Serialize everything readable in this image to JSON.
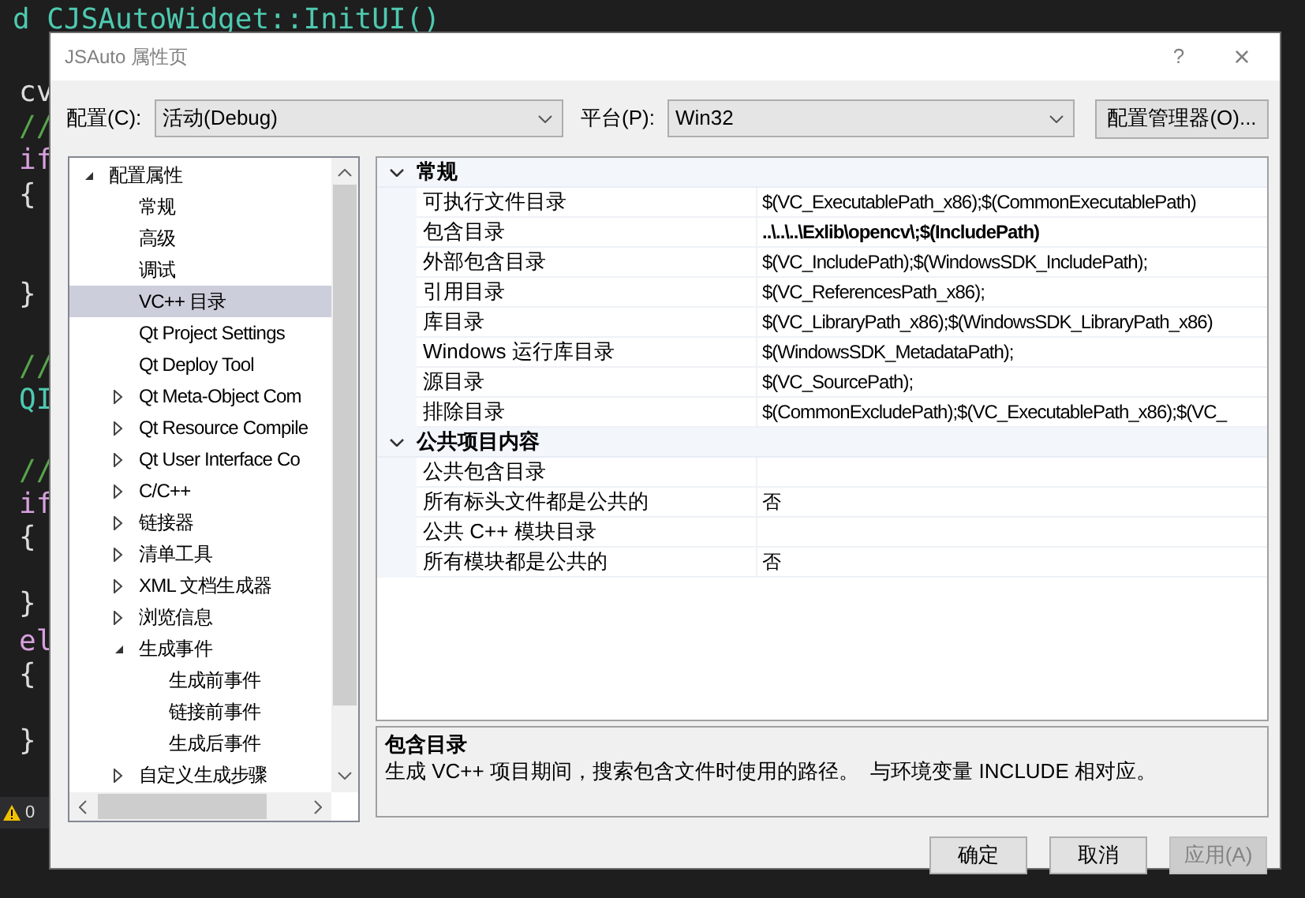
{
  "editor": {
    "lines": [
      {
        "text": "d CJSAutoWidget::InitUI()",
        "kind": "func"
      },
      {
        "text": "cv",
        "kind": "ident"
      },
      {
        "text": "//",
        "kind": "comment"
      },
      {
        "text": "if",
        "kind": "keyword"
      },
      {
        "text": "{",
        "kind": "brace"
      },
      {
        "text": "}",
        "kind": "brace"
      },
      {
        "text": "//",
        "kind": "comment"
      },
      {
        "text": "QI",
        "kind": "type"
      },
      {
        "text": "//",
        "kind": "comment"
      },
      {
        "text": "if",
        "kind": "keyword"
      },
      {
        "text": "{",
        "kind": "brace"
      },
      {
        "text": "}",
        "kind": "brace"
      },
      {
        "text": "el",
        "kind": "keyword"
      },
      {
        "text": "{",
        "kind": "brace"
      },
      {
        "text": "}",
        "kind": "brace"
      }
    ],
    "status": {
      "warnings": "0"
    }
  },
  "dialog": {
    "title": "JSAuto 属性页",
    "help": "?",
    "close": "×",
    "config_label": "配置(C):",
    "config_value": "活动(Debug)",
    "platform_label": "平台(P):",
    "platform_value": "Win32",
    "manager_button": "配置管理器(O)...",
    "tree": [
      {
        "label": "配置属性",
        "expanded": true,
        "children": [
          {
            "label": "常规",
            "selected": false
          },
          {
            "label": "高级",
            "selected": false
          },
          {
            "label": "调试",
            "selected": false
          },
          {
            "label": "VC++ 目录",
            "selected": true
          },
          {
            "label": "Qt Project Settings",
            "selected": false
          },
          {
            "label": "Qt Deploy Tool",
            "selected": false
          },
          {
            "label": "Qt Meta-Object Com",
            "selected": false,
            "expanded": false
          },
          {
            "label": "Qt Resource Compile",
            "selected": false,
            "expanded": false
          },
          {
            "label": "Qt User Interface Co",
            "selected": false,
            "expanded": false
          },
          {
            "label": "C/C++",
            "selected": false,
            "expanded": false
          },
          {
            "label": "链接器",
            "selected": false,
            "expanded": false
          },
          {
            "label": "清单工具",
            "selected": false,
            "expanded": false
          },
          {
            "label": "XML 文档生成器",
            "selected": false,
            "expanded": false
          },
          {
            "label": "浏览信息",
            "selected": false,
            "expanded": false
          },
          {
            "label": "生成事件",
            "selected": false,
            "expanded": true,
            "children": [
              {
                "label": "生成前事件",
                "selected": false
              },
              {
                "label": "链接前事件",
                "selected": false
              },
              {
                "label": "生成后事件",
                "selected": false
              }
            ]
          },
          {
            "label": "自定义生成步骤",
            "selected": false,
            "expanded": false
          }
        ]
      }
    ],
    "grid": [
      {
        "category": "常规",
        "expanded": true,
        "properties": [
          {
            "name": "可执行文件目录",
            "value": "$(VC_ExecutablePath_x86);$(CommonExecutablePath)",
            "modified": false
          },
          {
            "name": "包含目录",
            "value": "..\\..\\..\\Exlib\\opencv\\;$(IncludePath)",
            "modified": true
          },
          {
            "name": "外部包含目录",
            "value": "$(VC_IncludePath);$(WindowsSDK_IncludePath);",
            "modified": false
          },
          {
            "name": "引用目录",
            "value": "$(VC_ReferencesPath_x86);",
            "modified": false
          },
          {
            "name": "库目录",
            "value": "$(VC_LibraryPath_x86);$(WindowsSDK_LibraryPath_x86)",
            "modified": false
          },
          {
            "name": "Windows 运行库目录",
            "value": "$(WindowsSDK_MetadataPath);",
            "modified": false
          },
          {
            "name": "源目录",
            "value": "$(VC_SourcePath);",
            "modified": false
          },
          {
            "name": "排除目录",
            "value": "$(CommonExcludePath);$(VC_ExecutablePath_x86);$(VC_",
            "modified": false
          }
        ]
      },
      {
        "category": "公共项目内容",
        "expanded": true,
        "properties": [
          {
            "name": "公共包含目录",
            "modified": false
          },
          {
            "name": "所有标头文件都是公共的",
            "value": "否",
            "modified": false
          },
          {
            "name": "公共 C++ 模块目录",
            "modified": false
          },
          {
            "name": "所有模块都是公共的",
            "value": "否",
            "modified": false
          }
        ]
      }
    ],
    "description": {
      "title": "包含目录",
      "text": "生成 VC++ 项目期间，搜索包含文件时使用的路径。  与环境变量 INCLUDE 相对应。"
    },
    "buttons": [
      {
        "label": "确定",
        "disabled": false
      },
      {
        "label": "取消",
        "disabled": false
      },
      {
        "label": "应用(A)",
        "disabled": true
      }
    ]
  }
}
